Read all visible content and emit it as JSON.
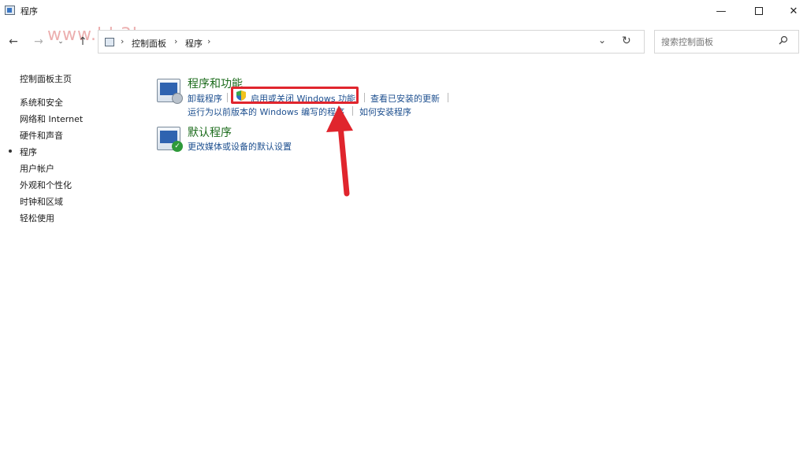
{
  "window": {
    "title": "程序",
    "minimize_glyph": "—",
    "close_glyph": "✕"
  },
  "watermark": "www.hh3h.com",
  "nav": {
    "back_glyph": "←",
    "forward_glyph": "→",
    "recent_glyph": "⌄",
    "up_glyph": "↑"
  },
  "address": {
    "crumbs": [
      "控制面板",
      "程序"
    ],
    "separator": "›",
    "dropdown_glyph": "⌄",
    "refresh_glyph": "↻"
  },
  "search": {
    "placeholder": "搜索控制面板"
  },
  "sidebar": {
    "items": [
      {
        "label": "控制面板主页"
      },
      {
        "label": "系统和安全"
      },
      {
        "label": "网络和 Internet"
      },
      {
        "label": "硬件和声音"
      },
      {
        "label": "程序",
        "selected": true
      },
      {
        "label": "用户帐户"
      },
      {
        "label": "外观和个性化"
      },
      {
        "label": "时钟和区域"
      },
      {
        "label": "轻松使用"
      }
    ]
  },
  "sections": [
    {
      "title": "程序和功能",
      "icon": "programs-features-icon",
      "links_row1": [
        "卸载程序",
        "启用或关闭 Windows 功能",
        "查看已安装的更新"
      ],
      "links_row2": [
        "运行为以前版本的 Windows 编写的程序",
        "如何安装程序"
      ]
    },
    {
      "title": "默认程序",
      "icon": "default-programs-icon",
      "links_row1": [
        "更改媒体或设备的默认设置"
      ]
    }
  ],
  "colors": {
    "section_title": "#1b6b1b",
    "link": "#1d4f8f",
    "highlight": "#e0252d",
    "arrow": "#e0252d"
  }
}
